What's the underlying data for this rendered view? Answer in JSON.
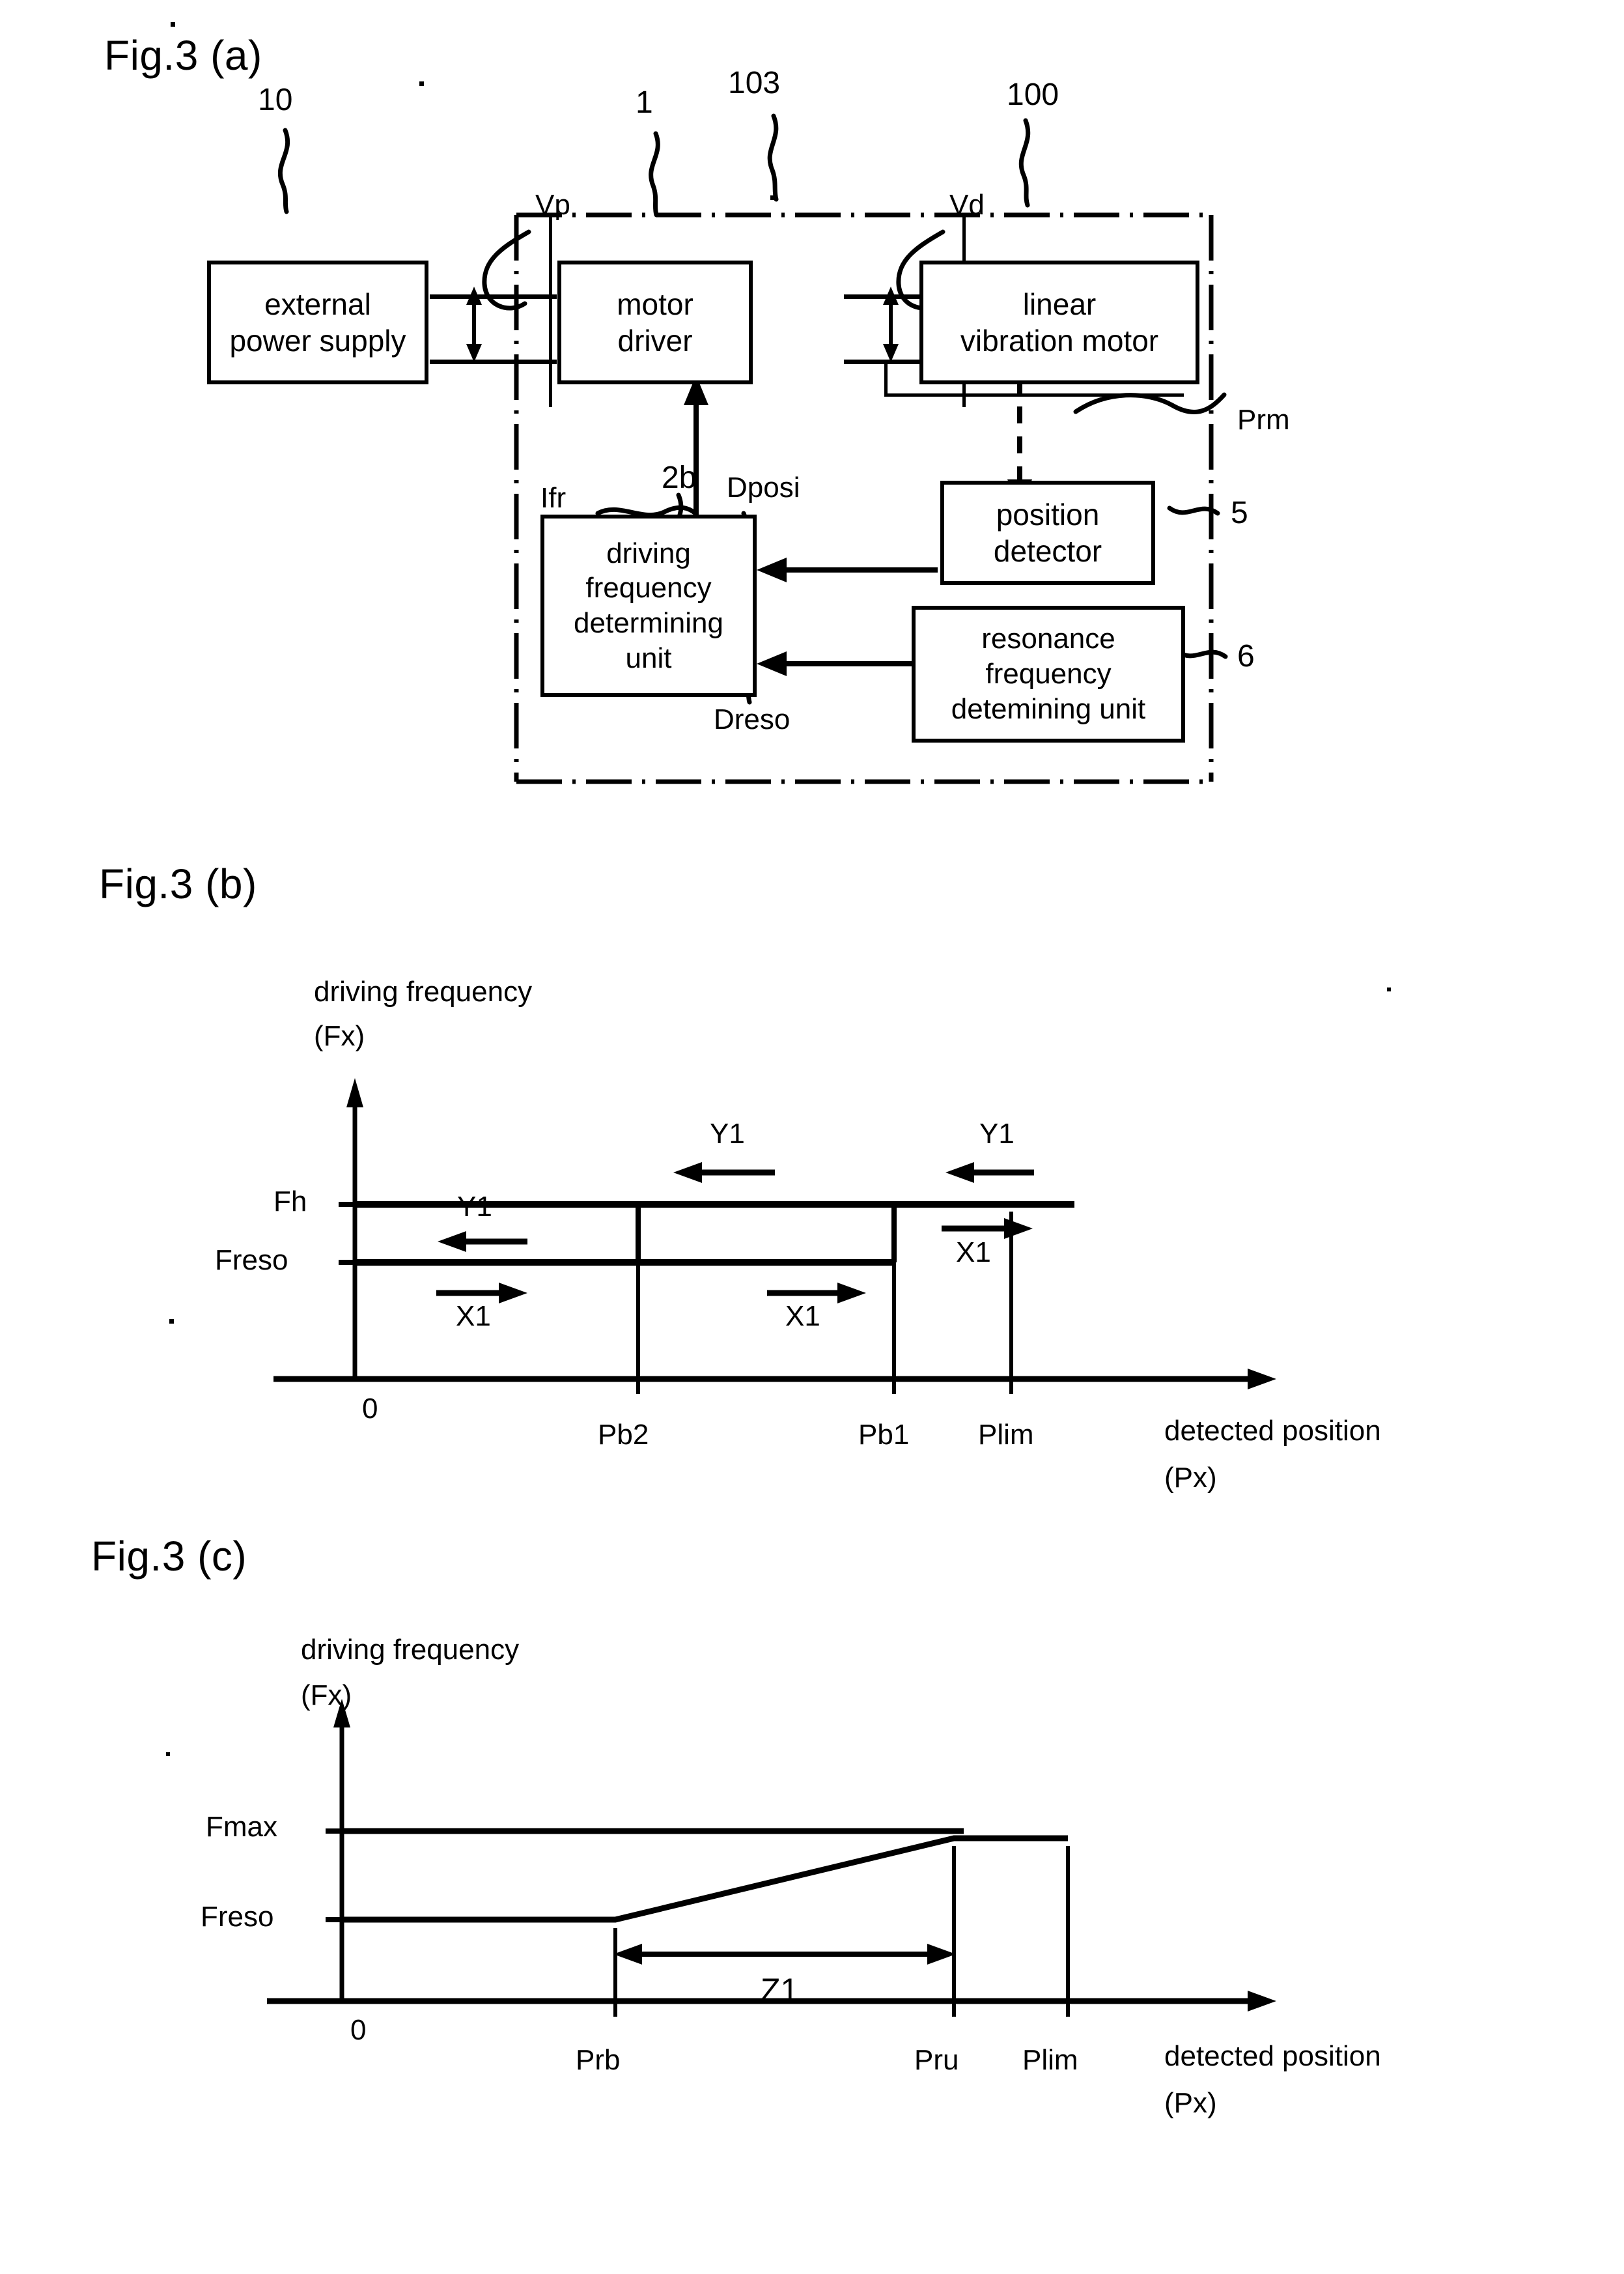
{
  "figures": {
    "a": {
      "title": "Fig.3 (a)",
      "blocks": {
        "external_power_supply": {
          "line1": "external",
          "line2": "power supply",
          "ref": "10"
        },
        "motor_driver": {
          "line1": "motor",
          "line2": "driver",
          "ref": "1"
        },
        "linear_vibration_motor": {
          "line1": "linear",
          "line2": "vibration motor",
          "ref": "100"
        },
        "driving_frequency_determining_unit": {
          "line1": "driving",
          "line2": "frequency",
          "line3": "determining",
          "line4": "unit",
          "ref": "2b"
        },
        "position_detector": {
          "line1": "position",
          "line2": "detector",
          "ref": "5"
        },
        "resonance_frequency_determining_unit": {
          "line1": "resonance",
          "line2": "frequency",
          "line3": "detemining unit",
          "ref": "6"
        }
      },
      "signals": {
        "vp": "Vp",
        "vd": "Vd",
        "ifr": "Ifr",
        "dposi": "Dposi",
        "dreso": "Dreso",
        "prm": "Prm"
      },
      "boundary_ref": "103"
    },
    "b": {
      "title": "Fig.3 (b)",
      "chart_data": {
        "type": "line",
        "title": "",
        "ylabel_line1": "driving frequency",
        "ylabel_line2": "(Fx)",
        "xlabel_line1": "detected position",
        "xlabel_line2": "(Px)",
        "origin_label": "0",
        "yticks": [
          "Freso",
          "Fh"
        ],
        "xticks": [
          "Pb2",
          "Pb1",
          "Plim"
        ],
        "annotations": [
          "Y1",
          "X1",
          "Y1",
          "X1",
          "Y1",
          "X1"
        ],
        "series": [
          {
            "name": "upper-branch",
            "description": "Fh level held from 0 to Plim (hysteresis upper path)",
            "points": [
              [
                0,
                "Fh"
              ],
              [
                "Pb2",
                "Fh"
              ],
              [
                "Pb1",
                "Fh"
              ],
              [
                "Plim",
                "Fh"
              ]
            ]
          },
          {
            "name": "lower-branch",
            "description": "Freso level held from 0 to Pb1, then steps up to Fh",
            "points": [
              [
                0,
                "Freso"
              ],
              [
                "Pb2",
                "Freso"
              ],
              [
                "Pb1",
                "Freso"
              ],
              [
                "Pb1",
                "Fh"
              ],
              [
                "Plim",
                "Fh"
              ]
            ]
          }
        ],
        "transitions": [
          {
            "label": "Y1",
            "direction": "left",
            "at": "between 0 and Pb2, Freso level"
          },
          {
            "label": "X1",
            "direction": "right",
            "at": "between 0 and Pb2, Freso level"
          },
          {
            "label": "Y1",
            "direction": "left",
            "at": "between Pb2 and Pb1, Fh level"
          },
          {
            "label": "X1",
            "direction": "right",
            "at": "between Pb2 and Pb1, Freso level"
          },
          {
            "label": "Y1",
            "direction": "left",
            "at": "right of Pb1, Fh level"
          },
          {
            "label": "X1",
            "direction": "right",
            "at": "right of Pb1, below Fh"
          }
        ]
      }
    },
    "c": {
      "title": "Fig.3 (c)",
      "chart_data": {
        "type": "line",
        "title": "",
        "ylabel_line1": "driving frequency",
        "ylabel_line2": "(Fx)",
        "xlabel_line1": "detected position",
        "xlabel_line2": "(Px)",
        "origin_label": "0",
        "yticks": [
          "Freso",
          "Fmax"
        ],
        "xticks": [
          "Prb",
          "Pru",
          "Plim"
        ],
        "span_label": "Z1",
        "series": [
          {
            "name": "upper-level",
            "description": "Fmax level from 0 to Plim",
            "points": [
              [
                0,
                "Fmax"
              ],
              [
                "Prb",
                "Fmax"
              ],
              [
                "Pru",
                "Fmax"
              ],
              [
                "Plim",
                "Fmax"
              ]
            ]
          },
          {
            "name": "ramp",
            "description": "Freso from 0 to Prb, linear rise to Fmax at Pru, then Fmax to Plim",
            "points": [
              [
                0,
                "Freso"
              ],
              [
                "Prb",
                "Freso"
              ],
              [
                "Pru",
                "Fmax"
              ],
              [
                "Plim",
                "Fmax"
              ]
            ]
          }
        ],
        "span": {
          "label": "Z1",
          "from": "Prb",
          "to": "Pru"
        }
      }
    }
  }
}
